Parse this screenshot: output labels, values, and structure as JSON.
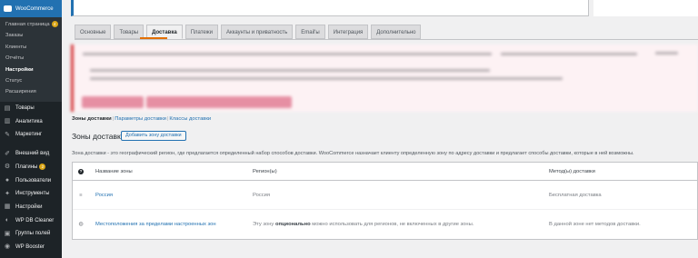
{
  "sidebar": {
    "woo_title": "WooCommerce",
    "submenu": [
      {
        "label": "Главная страница",
        "badge": "4"
      },
      {
        "label": "Заказы"
      },
      {
        "label": "Клиенты"
      },
      {
        "label": "Отчёты"
      },
      {
        "label": "Настройки",
        "active": true
      },
      {
        "label": "Статус"
      },
      {
        "label": "Расширения"
      }
    ],
    "menu": [
      {
        "icon": "products-icon",
        "glyph": "▤",
        "label": "Товары"
      },
      {
        "icon": "analytics-icon",
        "glyph": "▥",
        "label": "Аналитика"
      },
      {
        "icon": "marketing-icon",
        "glyph": "✎",
        "label": "Маркетинг"
      },
      {
        "icon": "appearance-icon",
        "glyph": "✐",
        "label": "Внешний вид"
      },
      {
        "icon": "plugins-icon",
        "glyph": "⚙",
        "label": "Плагины",
        "badge": "2"
      },
      {
        "icon": "users-icon",
        "glyph": "●",
        "label": "Пользователи"
      },
      {
        "icon": "tools-icon",
        "glyph": "✦",
        "label": "Инструменты"
      },
      {
        "icon": "settings-icon",
        "glyph": "▦",
        "label": "Настройки"
      },
      {
        "icon": "db-cleaner-icon",
        "glyph": "◐",
        "label": "WP DB Cleaner"
      },
      {
        "icon": "field-groups-icon",
        "glyph": "▣",
        "label": "Группы полей"
      },
      {
        "icon": "wp-booster-icon",
        "glyph": "◉",
        "label": "WP Booster"
      }
    ]
  },
  "tabs": [
    "Основные",
    "Товары",
    "Доставка",
    "Платежи",
    "Аккаунты и приватность",
    "Email'ы",
    "Интеграция",
    "Дополнительно"
  ],
  "active_tab": "Доставка",
  "subnav": {
    "current": "Зоны доставки",
    "links": [
      "Параметры доставки",
      "Классы доставки"
    ]
  },
  "zones_heading": "Зоны доставки",
  "add_zone_button": "Добавить зону доставки",
  "description": "Зона доставки - это географический регион, где предлагается определенный набор способов доставки. WooCommerce назначает клиенту определенную зону по адресу доставки и предлагает способы доставки, которые в ней возможны.",
  "table": {
    "help_glyph": "?",
    "headers": {
      "name": "Название зоны",
      "region": "Регион(ы)",
      "method": "Метод(ы) доставки"
    },
    "rows": [
      {
        "glyph": "≡",
        "name": "Россия",
        "region": "Россия",
        "method": "Бесплатная доставка"
      }
    ],
    "other_row": {
      "glyph": "◍",
      "name": "Местоположения за пределами настроенных зон",
      "region_prefix": "Эту зону ",
      "region_bold": "опционально",
      "region_suffix": " можно использовать для регионов, не включенных в другие зоны.",
      "method": "В данной зоне нет методов доставки."
    }
  }
}
